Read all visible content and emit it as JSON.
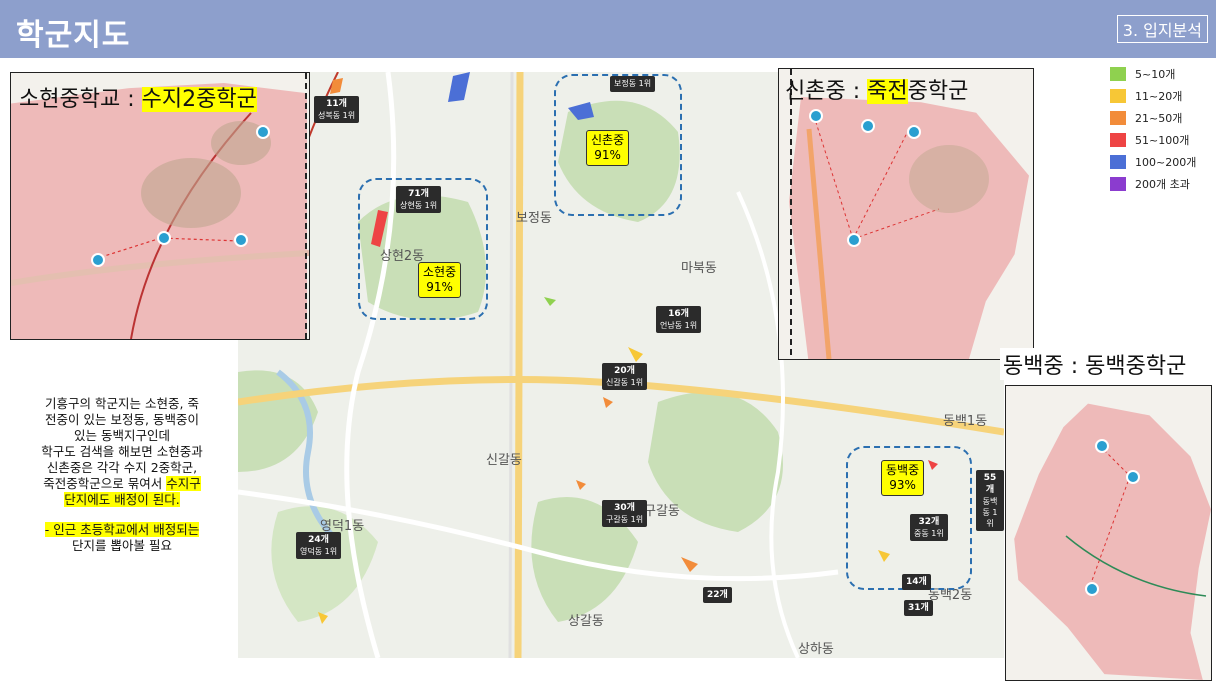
{
  "header": {
    "title": "학군지도",
    "section": "3. 입지분석"
  },
  "colors": {
    "header_bg": "#8d9fcc",
    "highlight": "#ffff00",
    "school_zone": "#e8787d"
  },
  "legend": [
    {
      "label": "5~10개",
      "color": "#8fd14f"
    },
    {
      "label": "11~20개",
      "color": "#f7c736"
    },
    {
      "label": "21~50개",
      "color": "#f28c3a"
    },
    {
      "label": "51~100개",
      "color": "#ee4444"
    },
    {
      "label": "100~200개",
      "color": "#4b6fd6"
    },
    {
      "label": "200개 초과",
      "color": "#8b3ccf"
    }
  ],
  "insets": {
    "sohyeon": {
      "title_a": "소현중학교 : ",
      "title_b": "수지2중학군"
    },
    "sinchon": {
      "title_a": "신촌중 : ",
      "title_b": "죽전",
      "title_c": "중학군"
    },
    "dongbaek": {
      "title": "동백중 : 동백중학군"
    }
  },
  "school_labels": {
    "sohyeon": {
      "name": "소현중",
      "pct": "91%"
    },
    "sinchon": {
      "name": "신촌중",
      "pct": "91%"
    },
    "dongbaek": {
      "name": "동백중",
      "pct": "93%"
    }
  },
  "map_tags": [
    {
      "count": "11개",
      "area": "성복동 1위"
    },
    {
      "count": "71개",
      "area": "상현동 1위"
    },
    {
      "count": "16개",
      "area": "언남동 1위"
    },
    {
      "count": "20개",
      "area": "신갈동 1위"
    },
    {
      "count": "30개",
      "area": "구갈동 1위"
    },
    {
      "count": "24개",
      "area": "영덕동 1위"
    },
    {
      "count": "22개",
      "area": ""
    },
    {
      "count": "55개",
      "area": "동백동 1위"
    },
    {
      "count": "32개",
      "area": "중동 1위"
    },
    {
      "count": "14개",
      "area": ""
    },
    {
      "count": "31개",
      "area": ""
    },
    {
      "count": "",
      "area": "보정동 1위"
    }
  ],
  "map_areas": [
    "상현2동",
    "보정동",
    "마북동",
    "신갈동",
    "구갈동",
    "영덕1동",
    "동백1동",
    "동백2동",
    "상갈동",
    "상하동"
  ],
  "note": {
    "lines": [
      "기흥구의 학군지는 소현중, 죽",
      "전중이 있는 보정동, 동백중이",
      "있는 동백지구인데",
      "학구도 검색을 해보면 소현중과",
      "신촌중은 각각 수지 2중학군,",
      "죽전중학군으로 묶여서"
    ],
    "highlight_1": "수지구",
    "highlight_2": "단지에도 배정이 된다.",
    "highlight_3": "- 인근 초등학교에서 배정되는",
    "line_last": "단지를 뽑아볼 필요"
  }
}
